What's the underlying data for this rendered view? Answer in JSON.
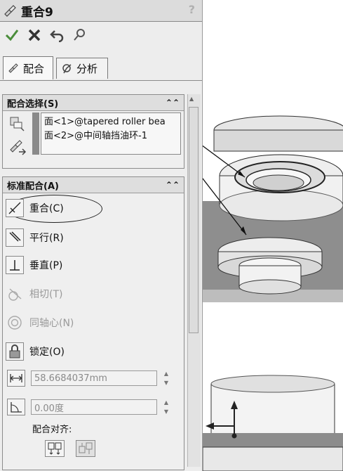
{
  "title": "重合9",
  "help_glyph": "?",
  "actions": [
    {
      "name": "ok-button",
      "icon": "check-icon",
      "color": "#3a7d2a"
    },
    {
      "name": "cancel-button",
      "icon": "close-icon",
      "color": "#b0281e"
    },
    {
      "name": "undo-button",
      "icon": "undo-icon",
      "color": "#555555"
    },
    {
      "name": "pushpin-button",
      "icon": "pin-icon",
      "color": "#555555"
    }
  ],
  "tabs": [
    {
      "label": "配合",
      "icon": "mate-icon",
      "active": true
    },
    {
      "label": "分析",
      "icon": "analysis-icon",
      "active": false
    }
  ],
  "mate_selection": {
    "header": "配合选择(S)",
    "items": [
      "面<1>@tapered roller bea",
      "面<2>@中间轴挡油环-1"
    ]
  },
  "standard_mates": {
    "header": "标准配合(A)",
    "items": [
      {
        "label": "重合(C)",
        "icon": "coincident-icon",
        "enabled": true,
        "selected": true
      },
      {
        "label": "平行(R)",
        "icon": "parallel-icon",
        "enabled": true
      },
      {
        "label": "垂直(P)",
        "icon": "perpendicular-icon",
        "enabled": true
      },
      {
        "label": "相切(T)",
        "icon": "tangent-icon",
        "enabled": false
      },
      {
        "label": "同轴心(N)",
        "icon": "concentric-icon",
        "enabled": false
      },
      {
        "label": "锁定(O)",
        "icon": "lock-icon",
        "enabled": true
      }
    ],
    "distance_value": "58.6684037mm",
    "angle_value": "0.00度",
    "alignment_label": "配合对齐:"
  }
}
